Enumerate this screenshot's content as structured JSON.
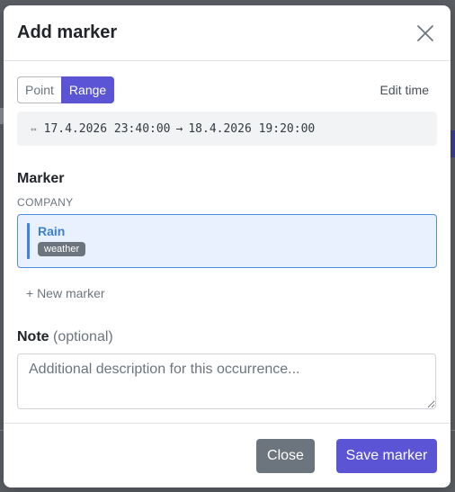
{
  "modal": {
    "title": "Add marker",
    "close_icon": "close-icon"
  },
  "mode": {
    "options": [
      "Point",
      "Range"
    ],
    "selected": "Range",
    "edit_time_label": "Edit time"
  },
  "time_range": {
    "icon": "↔",
    "start": "17.4.2026 23:40:00",
    "separator": "→",
    "end": "18.4.2026 19:20:00"
  },
  "marker_section": {
    "title": "Marker",
    "group": "COMPANY",
    "selected_marker": {
      "name": "Rain",
      "tag": "weather",
      "accent_color": "#3d84de"
    },
    "new_marker_label": "+ New marker"
  },
  "note": {
    "label": "Note",
    "optional": "(optional)",
    "placeholder": "Additional description for this occurrence...",
    "value": ""
  },
  "footer": {
    "close_label": "Close",
    "save_label": "Save marker"
  },
  "colors": {
    "primary": "#5b55d6",
    "secondary": "#6c757d",
    "selection": "#e8f1fd"
  }
}
